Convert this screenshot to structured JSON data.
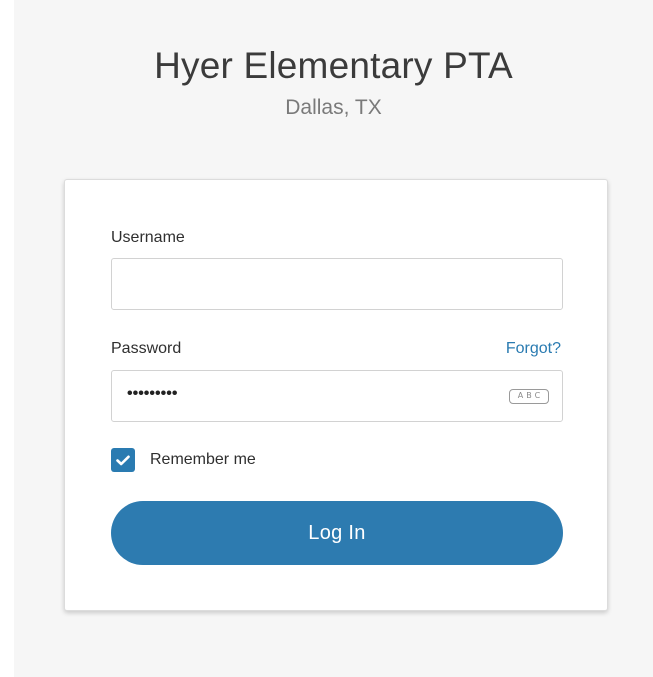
{
  "header": {
    "org_name": "Hyer Elementary PTA",
    "location": "Dallas, TX"
  },
  "login_form": {
    "username_label": "Username",
    "username_value": "",
    "password_label": "Password",
    "forgot_link": "Forgot?",
    "password_masked": "•••••••••",
    "keyboard_icon_text": "ABC",
    "remember_label": "Remember me",
    "remember_checked": true,
    "login_button": "Log In"
  },
  "colors": {
    "accent": "#2d7bb0",
    "link": "#2a7bb1",
    "page_bg": "#f6f6f6"
  },
  "icons": {
    "keyboard": "keyboard-abc-icon",
    "checkbox": "check-icon"
  }
}
